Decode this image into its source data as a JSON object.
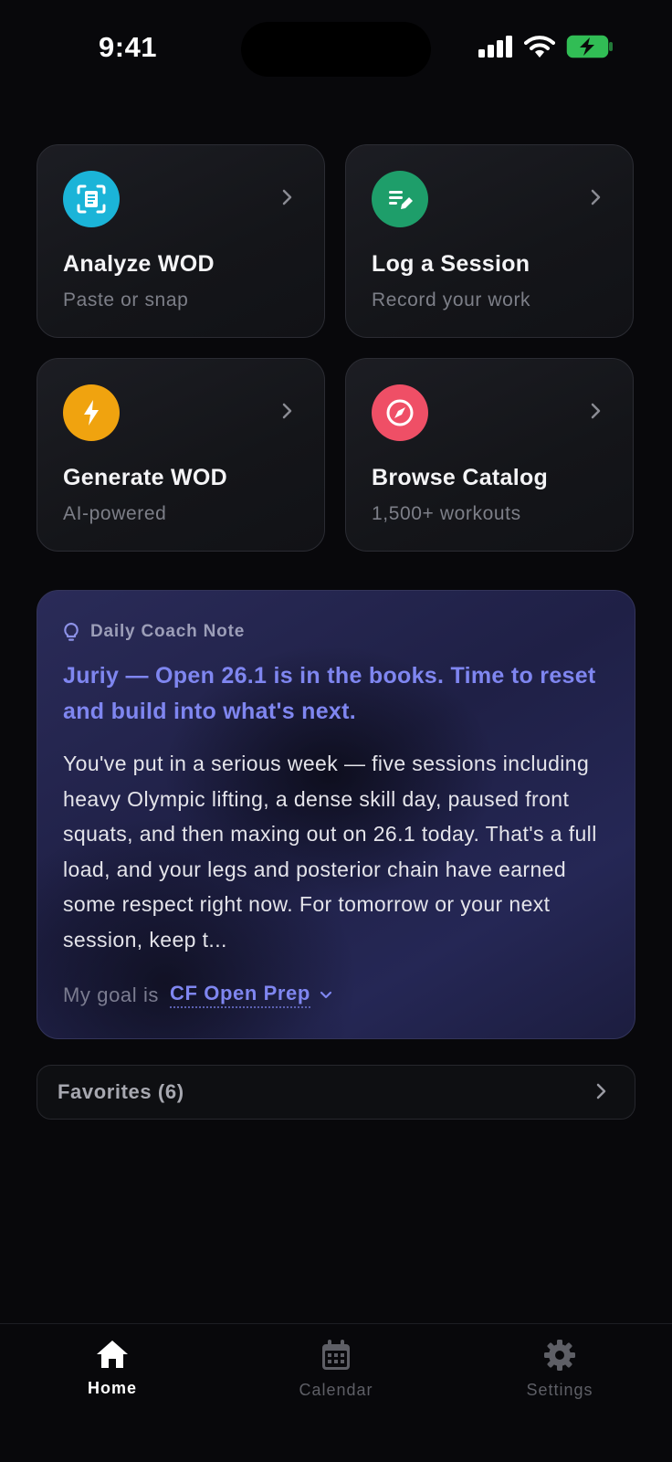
{
  "status_bar": {
    "time": "9:41"
  },
  "tiles": [
    {
      "title": "Analyze WOD",
      "subtitle": "Paste or snap",
      "icon": "scan-document-icon",
      "color": "#1bb4d8"
    },
    {
      "title": "Log a Session",
      "subtitle": "Record your work",
      "icon": "edit-notes-icon",
      "color": "#1e9e6a"
    },
    {
      "title": "Generate WOD",
      "subtitle": "AI-powered",
      "icon": "lightning-icon",
      "color": "#f0a30f"
    },
    {
      "title": "Browse Catalog",
      "subtitle": "1,500+ workouts",
      "icon": "compass-icon",
      "color": "#ef4f66"
    }
  ],
  "coach_note": {
    "label": "Daily Coach Note",
    "headline": "Juriy — Open 26.1 is in the books. Time to reset and build into what's next.",
    "body": "You've put in a serious week — five sessions including heavy Olympic lifting, a dense skill day, paused front squats, and then maxing out on 26.1 today. That's a full load, and your legs and posterior chain have earned some respect right now. For tomorrow or your next session, keep t...",
    "goal_prefix": "My goal is",
    "goal_value": "CF Open Prep",
    "accent": "#7f86f0"
  },
  "favorites": {
    "label": "Favorites (6)"
  },
  "tab_bar": {
    "tabs": [
      {
        "label": "Home",
        "active": true
      },
      {
        "label": "Calendar",
        "active": false
      },
      {
        "label": "Settings",
        "active": false
      }
    ]
  }
}
